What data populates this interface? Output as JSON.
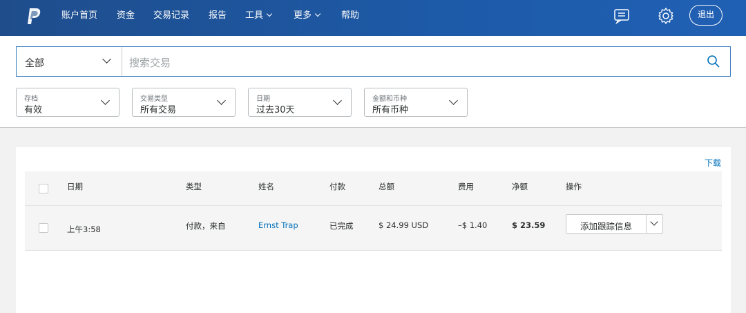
{
  "nav": {
    "items": [
      {
        "label": "账户首页",
        "caret": false
      },
      {
        "label": "资金",
        "caret": false
      },
      {
        "label": "交易记录",
        "caret": false
      },
      {
        "label": "报告",
        "caret": false
      },
      {
        "label": "工具",
        "caret": true
      },
      {
        "label": "更多",
        "caret": true
      },
      {
        "label": "帮助",
        "caret": false
      }
    ],
    "logout": "退出",
    "icons": [
      "paypal-logo-icon",
      "message-icon",
      "gear-icon"
    ]
  },
  "search": {
    "scope": "全部",
    "placeholder": "搜索交易"
  },
  "filters": [
    {
      "label": "存档",
      "value": "有效"
    },
    {
      "label": "交易类型",
      "value": "所有交易"
    },
    {
      "label": "日期",
      "value": "过去30天"
    },
    {
      "label": "金额和币种",
      "value": "所有币种"
    }
  ],
  "table": {
    "download": "下载",
    "headers": [
      "日期",
      "类型",
      "姓名",
      "付款",
      "总额",
      "费用",
      "净额",
      "操作"
    ],
    "rows": [
      {
        "date": "上午3:58",
        "type": "付款，来自",
        "name": "Ernst Trap",
        "status": "已完成",
        "gross": "$ 24.99 USD",
        "fee": "–$ 1.40",
        "net": "$ 23.59",
        "action": "添加跟踪信息"
      }
    ]
  },
  "colors": {
    "nav_bg": "#1d5aa8",
    "link": "#0070ba",
    "search_border": "#3d7fc1"
  }
}
